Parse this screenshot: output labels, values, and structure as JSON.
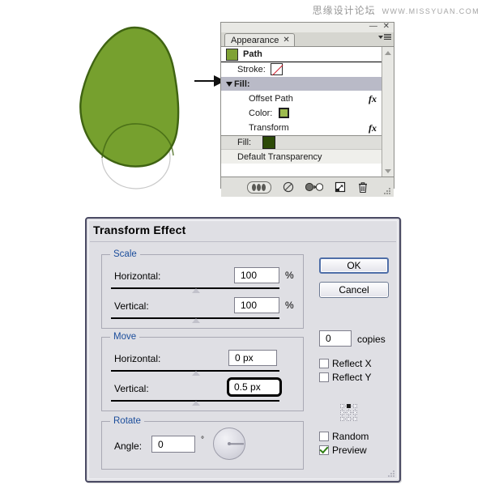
{
  "watermark": {
    "chinese": "思缘设计论坛",
    "url": "WWW.MISSYUAN.COM"
  },
  "illustration": {
    "name": "avocado-shape",
    "body_fill": "#76a02e",
    "body_stroke": "#3f6312",
    "offset_shape_fill": "#ffffff",
    "arrow": "→"
  },
  "appearance_panel": {
    "window_minimize": "—",
    "window_close": "✕",
    "tab": {
      "label": "Appearance",
      "close": "✕"
    },
    "rows": [
      {
        "label": "Path",
        "type": "path",
        "swatch": "#7fa235"
      },
      {
        "label": "Stroke:",
        "type": "stroke",
        "swatch": "none"
      },
      {
        "label": "Fill:",
        "type": "fill-header"
      },
      {
        "label": "Offset Path",
        "type": "effect",
        "fx": "fx"
      },
      {
        "label": "Color:",
        "type": "color",
        "swatch": "#9dbb4e"
      },
      {
        "label": "Transform",
        "type": "effect",
        "fx": "fx"
      },
      {
        "label": "Fill:",
        "type": "fill-bottom",
        "swatch": "#2c4a07"
      },
      {
        "label": "Default Transparency",
        "type": "transparency"
      }
    ],
    "footer_buttons": [
      {
        "name": "new-art-has-basic-appearance-toggle"
      },
      {
        "name": "clear-appearance-button"
      },
      {
        "name": "reduce-to-basic-appearance-button"
      },
      {
        "name": "duplicate-selected-item-button"
      },
      {
        "name": "delete-selected-item-button"
      }
    ]
  },
  "dialog": {
    "title": "Transform Effect",
    "scale": {
      "legend": "Scale",
      "horizontal_label": "Horizontal:",
      "horizontal_value": "100",
      "horizontal_unit": "%",
      "vertical_label": "Vertical:",
      "vertical_value": "100",
      "vertical_unit": "%"
    },
    "move": {
      "legend": "Move",
      "horizontal_label": "Horizontal:",
      "horizontal_value": "0 px",
      "vertical_label": "Vertical:",
      "vertical_value": "0.5 px"
    },
    "rotate": {
      "legend": "Rotate",
      "angle_label": "Angle:",
      "angle_value": "0",
      "angle_unit": "°"
    },
    "buttons": {
      "ok": "OK",
      "cancel": "Cancel"
    },
    "copies": {
      "value": "0",
      "label": "copies"
    },
    "options": [
      {
        "label": "Reflect X",
        "checked": false
      },
      {
        "label": "Reflect Y",
        "checked": false
      },
      {
        "label": "Random",
        "checked": false
      },
      {
        "label": "Preview",
        "checked": true
      }
    ],
    "reference_point": "top-center",
    "accent_color": "#1b4d9b",
    "check_color": "#2e7d12"
  }
}
